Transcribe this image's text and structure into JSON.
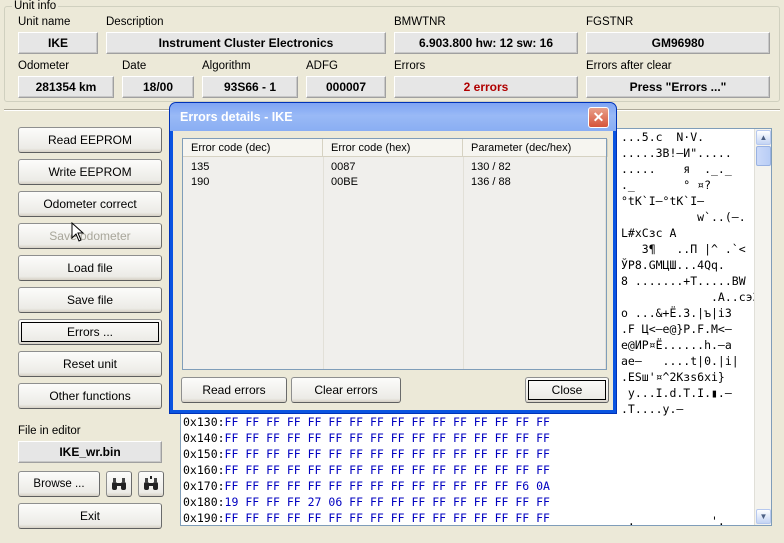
{
  "unit_info": {
    "group_title": "Unit info",
    "unit_name": {
      "label": "Unit name",
      "value": "IKE"
    },
    "description": {
      "label": "Description",
      "value": "Instrument Cluster Electronics"
    },
    "bmwtnr": {
      "label": "BMWTNR",
      "value": "6.903.800   hw: 12   sw: 16"
    },
    "fgstnr": {
      "label": "FGSTNR",
      "value": "GM96980"
    },
    "odometer": {
      "label": "Odometer",
      "value": "281354 km"
    },
    "date": {
      "label": "Date",
      "value": "18/00"
    },
    "algorithm": {
      "label": "Algorithm",
      "value": "93S66 - 1"
    },
    "adfg": {
      "label": "ADFG",
      "value": "000007"
    },
    "errors": {
      "label": "Errors",
      "value": "2 errors"
    },
    "errors_after_clear": {
      "label": "Errors after clear",
      "value": "Press \"Errors ...\""
    }
  },
  "buttons": {
    "read_eeprom": "Read EEPROM",
    "write_eeprom": "Write EEPROM",
    "odometer_correct": "Odometer correct",
    "save_odometer": "Save odometer",
    "load_file": "Load file",
    "save_file": "Save file",
    "errors": "Errors ...",
    "reset_unit": "Reset unit",
    "other_functions": "Other functions",
    "browse": "Browse ...",
    "exit": "Exit"
  },
  "file_in_editor": {
    "label": "File in editor",
    "value": "IKE_wr.bin"
  },
  "hex": {
    "rows": [
      {
        "addr": "0x130:",
        "bytes": "FF FF FF FF FF FF FF FF FF FF FF FF FF FF FF FF"
      },
      {
        "addr": "0x140:",
        "bytes": "FF FF FF FF FF FF FF FF FF FF FF FF FF FF FF FF"
      },
      {
        "addr": "0x150:",
        "bytes": "FF FF FF FF FF FF FF FF FF FF FF FF FF FF FF FF"
      },
      {
        "addr": "0x160:",
        "bytes": "FF FF FF FF FF FF FF FF FF FF FF FF FF FF FF FF"
      },
      {
        "addr": "0x170:",
        "bytes": "FF FF FF FF FF FF FF FF FF FF FF FF FF FF F6 0A"
      },
      {
        "addr": "0x180:",
        "bytes": "19 FF FF FF 27 06 FF FF FF FF FF FF FF FF FF FF"
      },
      {
        "addr": "0x190:",
        "bytes": "FF FF FF FF FF FF FF FF FF FF FF FF FF FF FF FF"
      }
    ],
    "ascii": "...5.c  N·V.\n.....ЗВ!–И\".....\n.....    я  ._._\n._       ° ¤?\n°tK`I–°tK`I–\n           w`..(–.\nL#хСзс А\n   З¶   ..П |^ .`<\nЎР8.GМЦШ...4Qq.\n8 .......+T.....BW\n             .A..cэ3\nо ...&+Ё.3.|ъ|і3\n.F Ц<–е@}Р.F.М<–\nе@ИР¤Ё......h.–а\nае–   ....t|0.|і|\n.ESш'¤^2Kзs6хі}\n y...I.d.T.I.▮.–\n.T....y.–\n\n\n\n\n\n                       ŭ.\n .           '.",
    "scroll_up": "▲",
    "scroll_down": "▼"
  },
  "dialog": {
    "title": "Errors details - IKE",
    "close_glyph": "✕",
    "columns": [
      "Error code (dec)",
      "Error code (hex)",
      "Parameter (dec/hex)"
    ],
    "rows": [
      [
        "135",
        "0087",
        "130 / 82"
      ],
      [
        "190",
        "00BE",
        "136 / 88"
      ]
    ],
    "read_errors": "Read errors",
    "clear_errors": "Clear errors",
    "close": "Close"
  },
  "icons": {
    "binoculars": "🔭"
  }
}
